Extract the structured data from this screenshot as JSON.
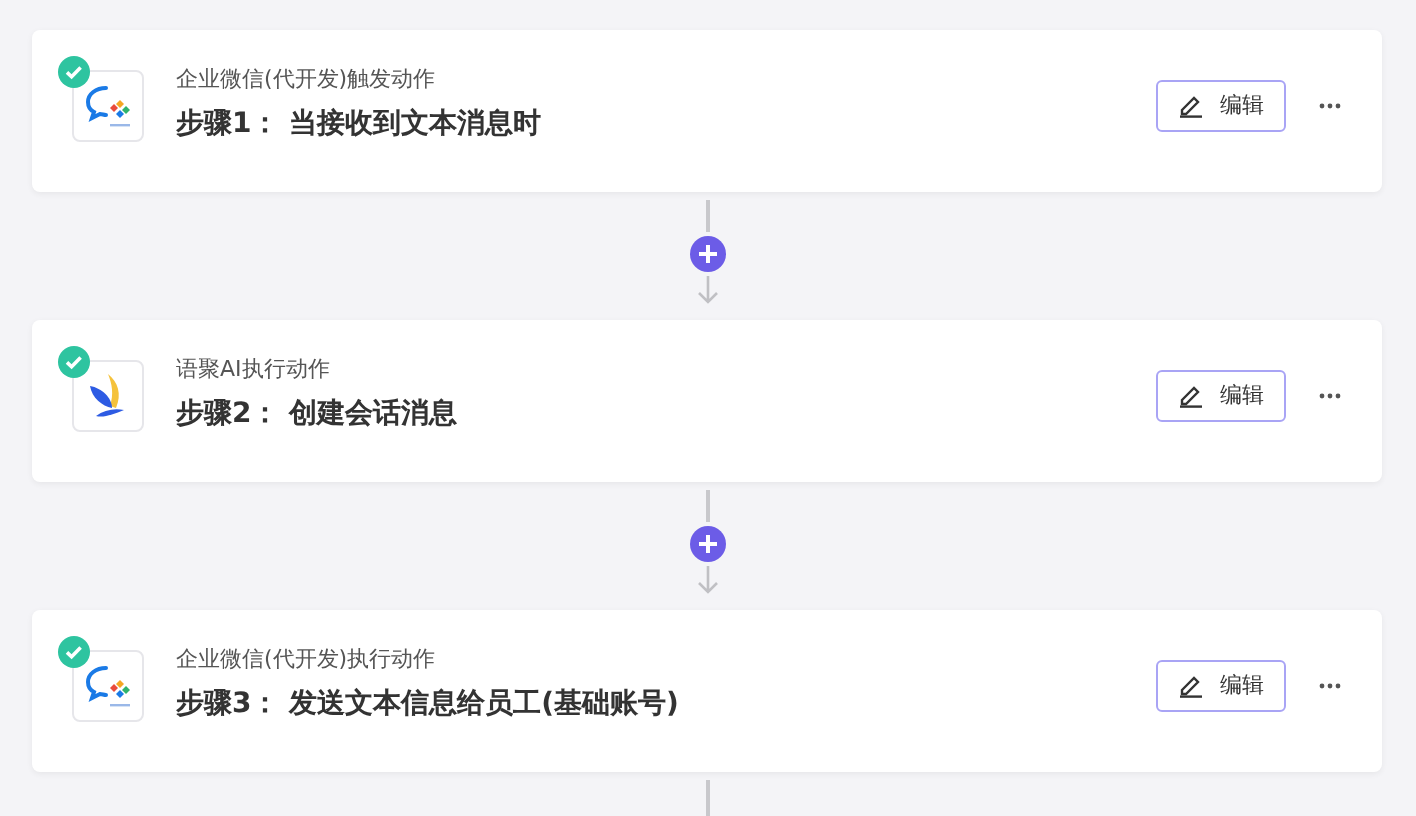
{
  "steps": [
    {
      "kind": "wecom",
      "completed": true,
      "category": "企业微信(代开发)触发动作",
      "title": "步骤1： 当接收到文本消息时",
      "edit_label": "编辑"
    },
    {
      "kind": "yuju",
      "completed": true,
      "category": "语聚AI执行动作",
      "title": "步骤2： 创建会话消息",
      "edit_label": "编辑"
    },
    {
      "kind": "wecom",
      "completed": true,
      "category": "企业微信(代开发)执行动作",
      "title": "步骤3： 发送文本信息给员工(基础账号)",
      "edit_label": "编辑"
    }
  ]
}
